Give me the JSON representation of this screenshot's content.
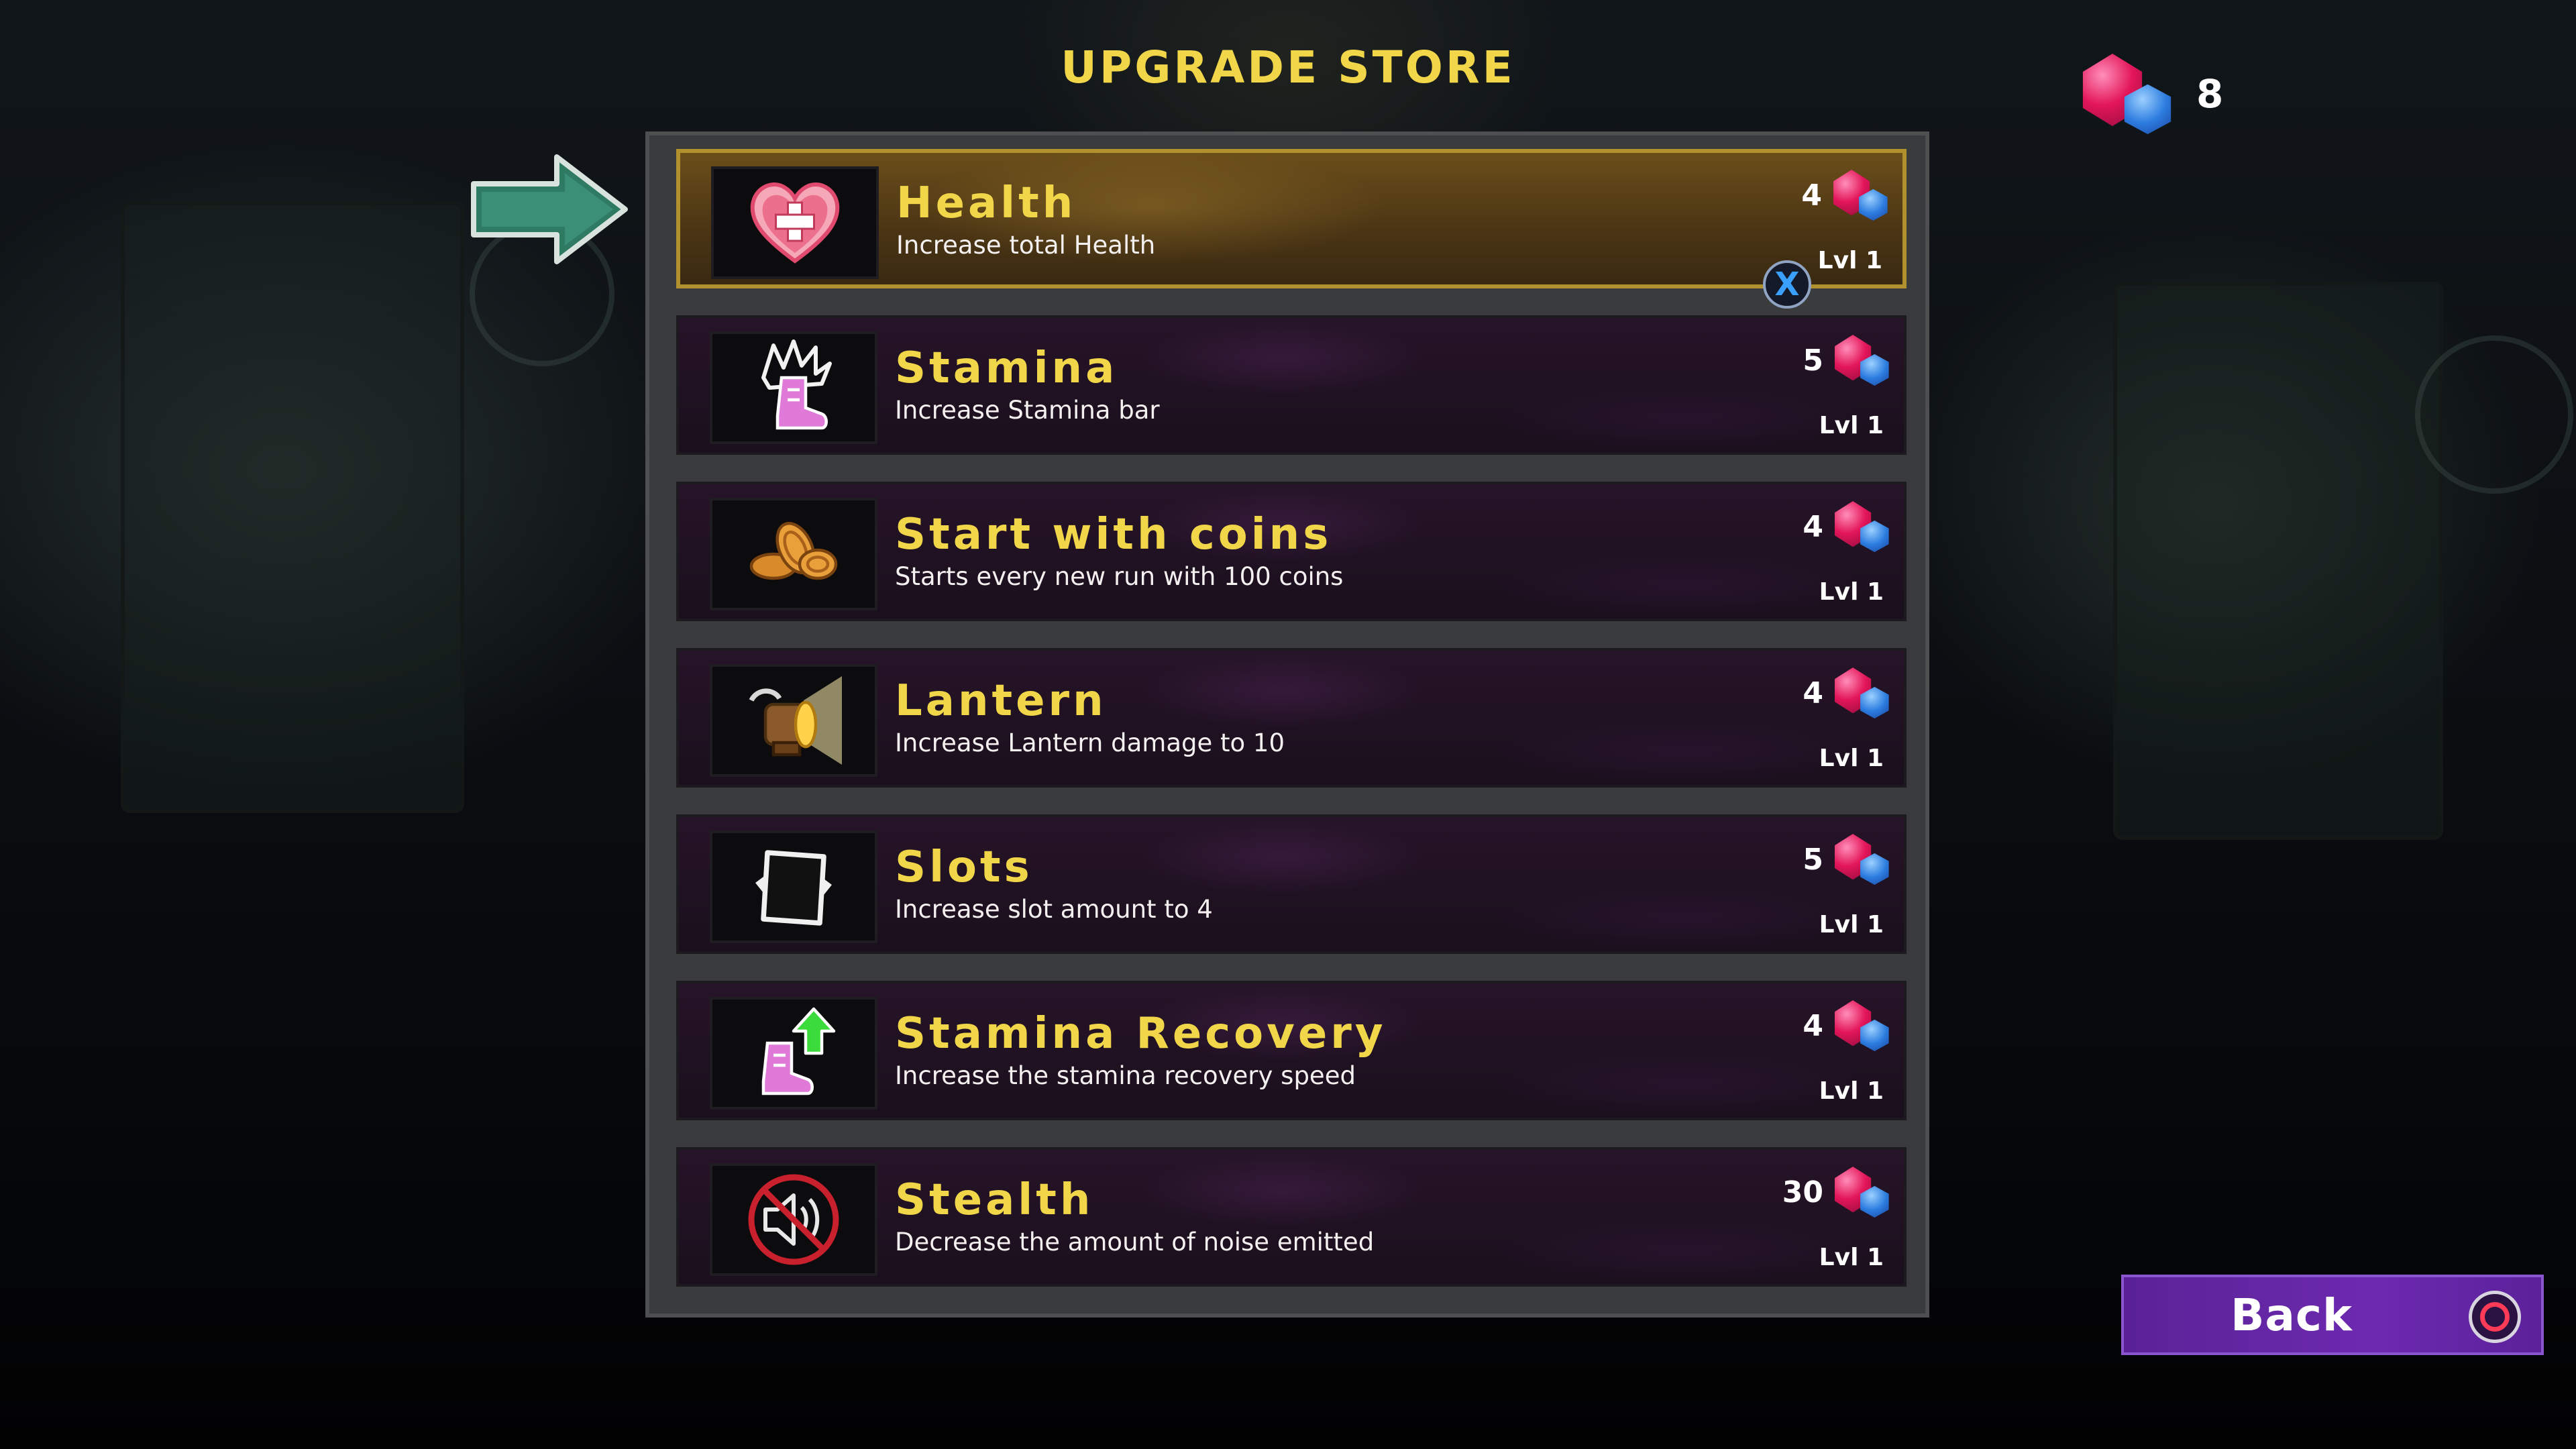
{
  "header": {
    "title": "UPGRADE STORE"
  },
  "currency": {
    "gems": "8",
    "icon": "gem-icon"
  },
  "upgrades": [
    {
      "name": "Health",
      "description": "Increase total Health",
      "cost": "4",
      "level": "Lvl 1",
      "icon": "heart-plus-icon"
    },
    {
      "name": "Stamina",
      "description": "Increase Stamina bar",
      "cost": "5",
      "level": "Lvl 1",
      "icon": "boot-icon"
    },
    {
      "name": "Start with coins",
      "description": "Starts every new run with 100 coins",
      "cost": "4",
      "level": "Lvl 1",
      "icon": "coins-icon"
    },
    {
      "name": "Lantern",
      "description": "Increase Lantern damage to 10",
      "cost": "4",
      "level": "Lvl 1",
      "icon": "lantern-icon"
    },
    {
      "name": "Slots",
      "description": "Increase slot amount to 4",
      "cost": "5",
      "level": "Lvl 1",
      "icon": "slot-card-icon"
    },
    {
      "name": "Stamina Recovery",
      "description": "Increase the stamina recovery speed",
      "cost": "4",
      "level": "Lvl 1",
      "icon": "boot-up-arrow-icon"
    },
    {
      "name": "Stealth",
      "description": "Decrease the amount of noise emitted",
      "cost": "30",
      "level": "Lvl 1",
      "icon": "muted-speaker-icon"
    }
  ],
  "selected_prompt": {
    "button": "X"
  },
  "back_button": {
    "label": "Back",
    "icon": "circle-button-icon"
  },
  "colors": {
    "title": "#f2d64a",
    "selected_border": "#b0912e",
    "back_bg": "#6d2ab0"
  }
}
